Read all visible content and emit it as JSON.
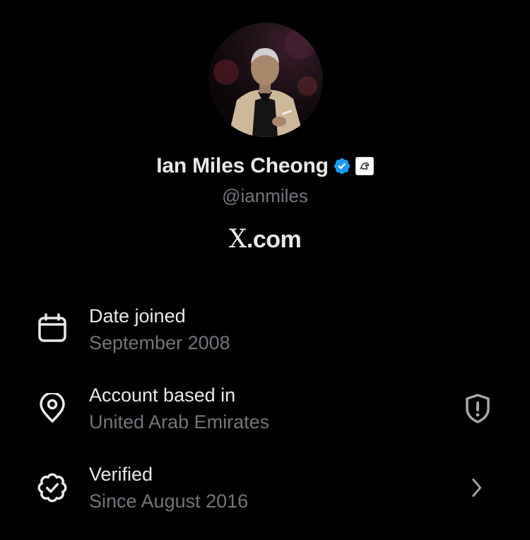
{
  "profile": {
    "name": "Ian Miles Cheong",
    "handle": "@ianmiles",
    "site": "X.com",
    "site_mark": "X",
    "site_suffix": ".com"
  },
  "colors": {
    "background": "#000000",
    "primary_text": "#e7e9ea",
    "secondary_text": "#71767b",
    "verified_blue": "#1d9bf0"
  },
  "details": [
    {
      "icon": "calendar-icon",
      "title": "Date joined",
      "value": "September 2008"
    },
    {
      "icon": "location-pin-icon",
      "title": "Account based in",
      "value": "United Arab Emirates",
      "trailing_icon": "shield-alert-icon"
    },
    {
      "icon": "verified-badge-icon",
      "title": "Verified",
      "value": "Since August 2016",
      "trailing_icon": "chevron-right-icon"
    }
  ]
}
